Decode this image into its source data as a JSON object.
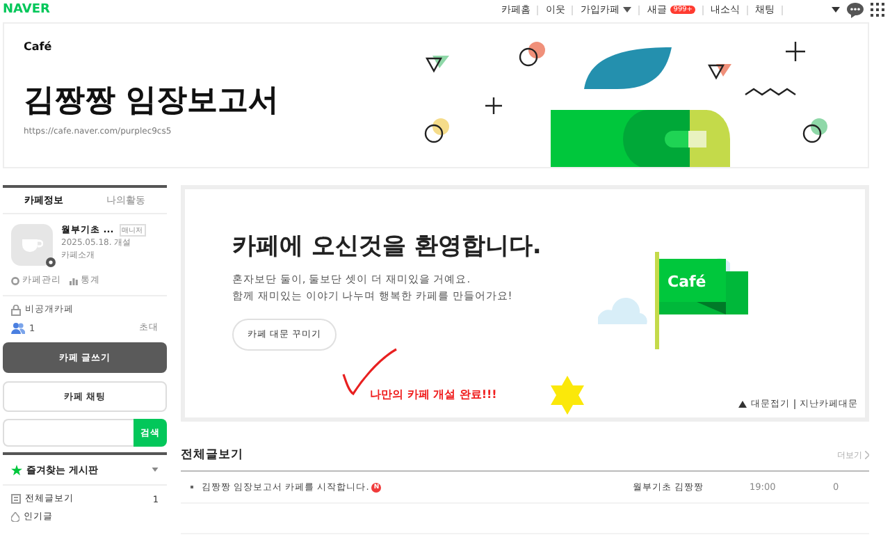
{
  "top_bar": {
    "logo": "NAVER",
    "links": [
      {
        "label": "카페홈",
        "dropdown": false
      },
      {
        "label": "이웃",
        "dropdown": false
      },
      {
        "label": "가입카페",
        "dropdown": true
      },
      {
        "label": "새글",
        "dropdown": false,
        "badge": "999+"
      },
      {
        "label": "내소식",
        "dropdown": false
      },
      {
        "label": "채팅",
        "dropdown": false
      }
    ]
  },
  "header": {
    "logo": "Café",
    "title": "김짱짱 임장보고서",
    "url": "https://cafe.naver.com/purplec9cs5"
  },
  "sidebar": {
    "tabs": [
      {
        "label": "카페정보",
        "selected": true
      },
      {
        "label": "나의활동",
        "selected": false
      }
    ],
    "profile": {
      "name": "월부기초 ...",
      "role": "매니저",
      "date": "2025.05.18. 개설",
      "intro_link": "카페소개"
    },
    "admin_links": [
      "카페관리",
      "통계"
    ],
    "privacy": "비공개카페",
    "members": "1",
    "invite": "초대",
    "write_button": "카페 글쓰기",
    "chat_button": "카페 채팅",
    "search_button": "검색",
    "favorites": "즐겨찾는 게시판",
    "boards": [
      {
        "kind": "all",
        "name": "전체글보기",
        "count": "1"
      },
      {
        "kind": "popular",
        "name": "인기글"
      }
    ]
  },
  "welcome": {
    "title": "카페에 오신것을 환영합니다.",
    "lines": [
      "혼자보단 둘이, 둘보단 셋이 더 재미있을 거예요.",
      "함께 재미있는 이야기 나누며 행복한 카페를 만들어가요!"
    ],
    "button": "카페 대문 꾸미기",
    "annotation": "나만의 카페 개설 완료!!!",
    "flag_label": "Café",
    "footer_links": [
      "대문접기",
      "지난카페대문"
    ]
  },
  "posts": {
    "title": "전체글보기",
    "more": "더보기",
    "rows": [
      {
        "title": "김짱짱 임장보고서 카페를 시작합니다.",
        "new_badge": "N",
        "author": "월부기초 김짱짱",
        "time": "19:00",
        "views": "0"
      }
    ]
  }
}
